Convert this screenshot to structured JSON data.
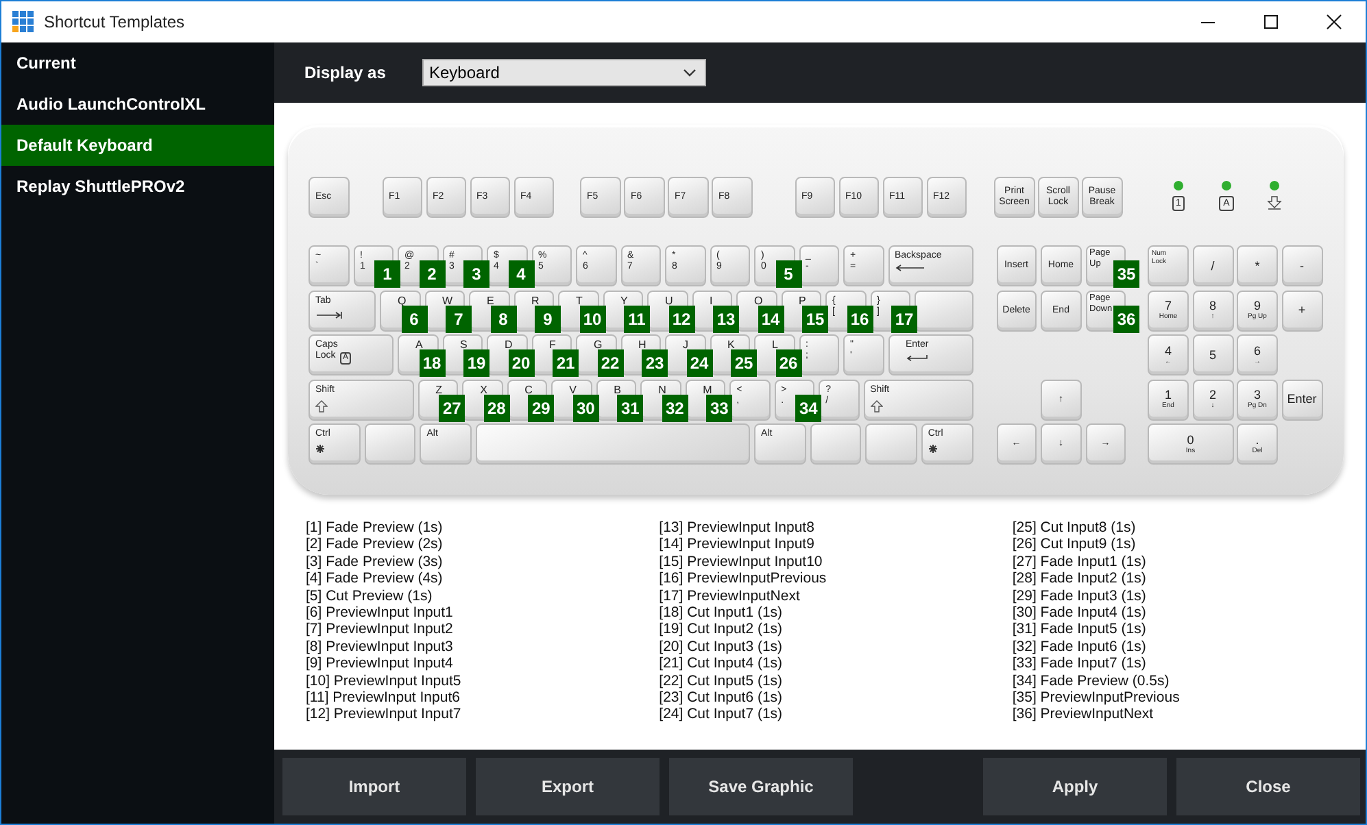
{
  "window": {
    "title": "Shortcut Templates"
  },
  "sidebar": {
    "items": [
      {
        "label": "Current",
        "selected": false
      },
      {
        "label": "Audio LaunchControlXL",
        "selected": false
      },
      {
        "label": "Default Keyboard",
        "selected": true
      },
      {
        "label": "Replay ShuttlePROv2",
        "selected": false
      }
    ]
  },
  "toolbar": {
    "label": "Display as",
    "dropdown": {
      "value": "Keyboard"
    }
  },
  "keyboard": {
    "function_row": [
      [
        {
          "kind": "fkey",
          "labels": [
            "Esc"
          ]
        }
      ],
      [
        {
          "kind": "fkey",
          "labels": [
            "F1"
          ]
        },
        {
          "kind": "fkey",
          "labels": [
            "F2"
          ]
        },
        {
          "kind": "fkey",
          "labels": [
            "F3"
          ]
        },
        {
          "kind": "fkey",
          "labels": [
            "F4"
          ]
        }
      ],
      [
        {
          "kind": "fkey",
          "labels": [
            "F5"
          ]
        },
        {
          "kind": "fkey",
          "labels": [
            "F6"
          ]
        },
        {
          "kind": "fkey",
          "labels": [
            "F7"
          ]
        },
        {
          "kind": "fkey",
          "labels": [
            "F8"
          ]
        }
      ],
      [
        {
          "kind": "fkey",
          "labels": [
            "F9"
          ]
        },
        {
          "kind": "fkey",
          "labels": [
            "F10"
          ]
        },
        {
          "kind": "fkey",
          "labels": [
            "F11"
          ]
        },
        {
          "kind": "fkey",
          "labels": [
            "F12"
          ]
        }
      ],
      [
        {
          "kind": "nav",
          "labels": [
            "Print",
            "Screen"
          ]
        },
        {
          "kind": "nav",
          "labels": [
            "Scroll",
            "Lock"
          ]
        },
        {
          "kind": "nav",
          "labels": [
            "Pause",
            "Break"
          ]
        }
      ]
    ],
    "leds": [
      {
        "symbol": "1",
        "on": true
      },
      {
        "symbol": "A",
        "on": true
      },
      {
        "kind": "scroll",
        "on": true
      }
    ],
    "main_rows": [
      [
        {
          "kind": "key",
          "labels": [
            "~",
            "`"
          ]
        },
        {
          "kind": "key",
          "labels": [
            "!",
            "1"
          ],
          "badge": "1"
        },
        {
          "kind": "key",
          "labels": [
            "@",
            "2"
          ],
          "badge": "2"
        },
        {
          "kind": "key",
          "labels": [
            "#",
            "3"
          ],
          "badge": "3"
        },
        {
          "kind": "key",
          "labels": [
            "$",
            "4"
          ],
          "badge": "4"
        },
        {
          "kind": "key",
          "labels": [
            "%",
            "5"
          ]
        },
        {
          "kind": "key",
          "labels": [
            "^",
            "6"
          ]
        },
        {
          "kind": "key",
          "labels": [
            "&",
            "7"
          ]
        },
        {
          "kind": "key",
          "labels": [
            "*",
            "8"
          ]
        },
        {
          "kind": "key",
          "labels": [
            "(",
            "9"
          ]
        },
        {
          "kind": "key",
          "labels": [
            ")",
            "0"
          ],
          "badge": "5"
        },
        {
          "kind": "key",
          "labels": [
            "_",
            "-"
          ]
        },
        {
          "kind": "key",
          "labels": [
            "+",
            "="
          ]
        },
        {
          "kind": "backspace",
          "labels": [
            "Backspace"
          ]
        }
      ],
      [
        {
          "kind": "tab",
          "labels": [
            "Tab"
          ]
        },
        {
          "kind": "key",
          "labels": [
            "Q"
          ],
          "badge": "6"
        },
        {
          "kind": "key",
          "labels": [
            "W"
          ],
          "badge": "7"
        },
        {
          "kind": "key",
          "labels": [
            "E"
          ],
          "badge": "8"
        },
        {
          "kind": "key",
          "labels": [
            "R"
          ],
          "badge": "9"
        },
        {
          "kind": "key",
          "labels": [
            "T"
          ],
          "badge": "10"
        },
        {
          "kind": "key",
          "labels": [
            "Y"
          ],
          "badge": "11"
        },
        {
          "kind": "key",
          "labels": [
            "U"
          ],
          "badge": "12"
        },
        {
          "kind": "key",
          "labels": [
            "I"
          ],
          "badge": "13"
        },
        {
          "kind": "key",
          "labels": [
            "O"
          ],
          "badge": "14"
        },
        {
          "kind": "key",
          "labels": [
            "P"
          ],
          "badge": "15"
        },
        {
          "kind": "key",
          "labels": [
            "{",
            "["
          ],
          "badge": "16"
        },
        {
          "kind": "key",
          "labels": [
            "}",
            "]"
          ],
          "badge": "17"
        },
        {
          "kind": "enter-top"
        }
      ],
      [
        {
          "kind": "caps",
          "labels": [
            "Caps",
            "Lock"
          ],
          "symbol": "A"
        },
        {
          "kind": "key",
          "labels": [
            "A"
          ],
          "badge": "18"
        },
        {
          "kind": "key",
          "labels": [
            "S"
          ],
          "badge": "19"
        },
        {
          "kind": "key",
          "labels": [
            "D"
          ],
          "badge": "20"
        },
        {
          "kind": "key",
          "labels": [
            "F"
          ],
          "badge": "21"
        },
        {
          "kind": "key",
          "labels": [
            "G"
          ],
          "badge": "22"
        },
        {
          "kind": "key",
          "labels": [
            "H"
          ],
          "badge": "23"
        },
        {
          "kind": "key",
          "labels": [
            "J"
          ],
          "badge": "24"
        },
        {
          "kind": "key",
          "labels": [
            "K"
          ],
          "badge": "25"
        },
        {
          "kind": "key",
          "labels": [
            "L"
          ],
          "badge": "26"
        },
        {
          "kind": "key",
          "labels": [
            ":",
            ";"
          ]
        },
        {
          "kind": "key",
          "labels": [
            "\"",
            "'"
          ]
        },
        {
          "kind": "enter",
          "labels": [
            "Enter"
          ]
        }
      ],
      [
        {
          "kind": "lshift",
          "labels": [
            "Shift"
          ]
        },
        {
          "kind": "key",
          "labels": [
            "Z"
          ],
          "badge": "27"
        },
        {
          "kind": "key",
          "labels": [
            "X"
          ],
          "badge": "28"
        },
        {
          "kind": "key",
          "labels": [
            "C"
          ],
          "badge": "29"
        },
        {
          "kind": "key",
          "labels": [
            "V"
          ],
          "badge": "30"
        },
        {
          "kind": "key",
          "labels": [
            "B"
          ],
          "badge": "31"
        },
        {
          "kind": "key",
          "labels": [
            "N"
          ],
          "badge": "32"
        },
        {
          "kind": "key",
          "labels": [
            "M"
          ],
          "badge": "33"
        },
        {
          "kind": "key",
          "labels": [
            "<",
            ","
          ]
        },
        {
          "kind": "key",
          "labels": [
            ">",
            "."
          ],
          "badge": "34"
        },
        {
          "kind": "key",
          "labels": [
            "?",
            "/"
          ]
        },
        {
          "kind": "rshift",
          "labels": [
            "Shift"
          ]
        }
      ],
      [
        {
          "kind": "ctrl",
          "labels": [
            "Ctrl"
          ]
        },
        {
          "kind": "win"
        },
        {
          "kind": "alt",
          "labels": [
            "Alt"
          ]
        },
        {
          "kind": "space"
        },
        {
          "kind": "alt",
          "labels": [
            "Alt"
          ]
        },
        {
          "kind": "win"
        },
        {
          "kind": "menu"
        },
        {
          "kind": "ctrl",
          "labels": [
            "Ctrl"
          ]
        }
      ]
    ],
    "nav_rows": [
      [
        {
          "kind": "nav",
          "labels": [
            "Insert"
          ]
        },
        {
          "kind": "nav",
          "labels": [
            "Home"
          ]
        },
        {
          "kind": "nav",
          "labels": [
            "Page",
            "Up"
          ],
          "badge": "35"
        }
      ],
      [
        {
          "kind": "nav",
          "labels": [
            "Delete"
          ]
        },
        {
          "kind": "nav",
          "labels": [
            "End"
          ]
        },
        {
          "kind": "nav",
          "labels": [
            "Page",
            "Down"
          ],
          "badge": "36"
        }
      ],
      [],
      [
        {
          "kind": "gap"
        },
        {
          "kind": "nav",
          "labels": [
            "↑"
          ]
        },
        {
          "kind": "gap"
        }
      ],
      [
        {
          "kind": "nav",
          "labels": [
            "←"
          ]
        },
        {
          "kind": "nav",
          "labels": [
            "↓"
          ]
        },
        {
          "kind": "nav",
          "labels": [
            "→"
          ]
        }
      ]
    ],
    "numpad": [
      {
        "kind": "numlock",
        "labels": [
          "Num",
          "Lock"
        ]
      },
      {
        "kind": "num",
        "labels": [
          "/"
        ]
      },
      {
        "kind": "num",
        "labels": [
          "*"
        ]
      },
      {
        "kind": "num",
        "labels": [
          "-"
        ]
      },
      {
        "kind": "num",
        "labels": [
          "7",
          "Home"
        ]
      },
      {
        "kind": "num",
        "labels": [
          "8",
          "↑"
        ]
      },
      {
        "kind": "num",
        "labels": [
          "9",
          "Pg Up"
        ]
      },
      {
        "kind": "tall",
        "labels": [
          "+"
        ]
      },
      {
        "kind": "num",
        "labels": [
          "4",
          "←"
        ]
      },
      {
        "kind": "num",
        "labels": [
          "5"
        ]
      },
      {
        "kind": "num",
        "labels": [
          "6",
          "→"
        ]
      },
      {
        "kind": "num",
        "labels": [
          "1",
          "End"
        ]
      },
      {
        "kind": "num",
        "labels": [
          "2",
          "↓"
        ]
      },
      {
        "kind": "num",
        "labels": [
          "3",
          "Pg Dn"
        ]
      },
      {
        "kind": "tall",
        "labels": [
          "Enter"
        ]
      },
      {
        "kind": "wide",
        "labels": [
          "0",
          "Ins"
        ]
      },
      {
        "kind": "num",
        "labels": [
          ".",
          "Del"
        ]
      }
    ]
  },
  "legend": {
    "columns": [
      [
        "[1] Fade Preview (1s)",
        "[2] Fade Preview (2s)",
        "[3] Fade Preview (3s)",
        "[4] Fade Preview (4s)",
        "[5] Cut Preview (1s)",
        "[6] PreviewInput Input1",
        "[7] PreviewInput Input2",
        "[8] PreviewInput Input3",
        "[9] PreviewInput Input4",
        "[10] PreviewInput Input5",
        "[11] PreviewInput Input6",
        "[12] PreviewInput Input7"
      ],
      [
        "[13] PreviewInput Input8",
        "[14] PreviewInput Input9",
        "[15] PreviewInput Input10",
        "[16] PreviewInputPrevious",
        "[17] PreviewInputNext",
        "[18] Cut Input1 (1s)",
        "[19] Cut Input2 (1s)",
        "[20] Cut Input3 (1s)",
        "[21] Cut Input4 (1s)",
        "[22] Cut Input5 (1s)",
        "[23] Cut Input6 (1s)",
        "[24] Cut Input7 (1s)"
      ],
      [
        "[25] Cut Input8 (1s)",
        "[26] Cut Input9 (1s)",
        "[27] Fade Input1 (1s)",
        "[28] Fade Input2 (1s)",
        "[29] Fade Input3 (1s)",
        "[30] Fade Input4 (1s)",
        "[31] Fade Input5 (1s)",
        "[32] Fade Input6 (1s)",
        "[33] Fade Input7 (1s)",
        "[34] Fade Preview (0.5s)",
        "[35] PreviewInputPrevious",
        "[36] PreviewInputNext"
      ]
    ]
  },
  "footer": {
    "left_buttons": [
      "Import",
      "Export",
      "Save Graphic"
    ],
    "right_buttons": [
      "Apply",
      "Close"
    ]
  }
}
